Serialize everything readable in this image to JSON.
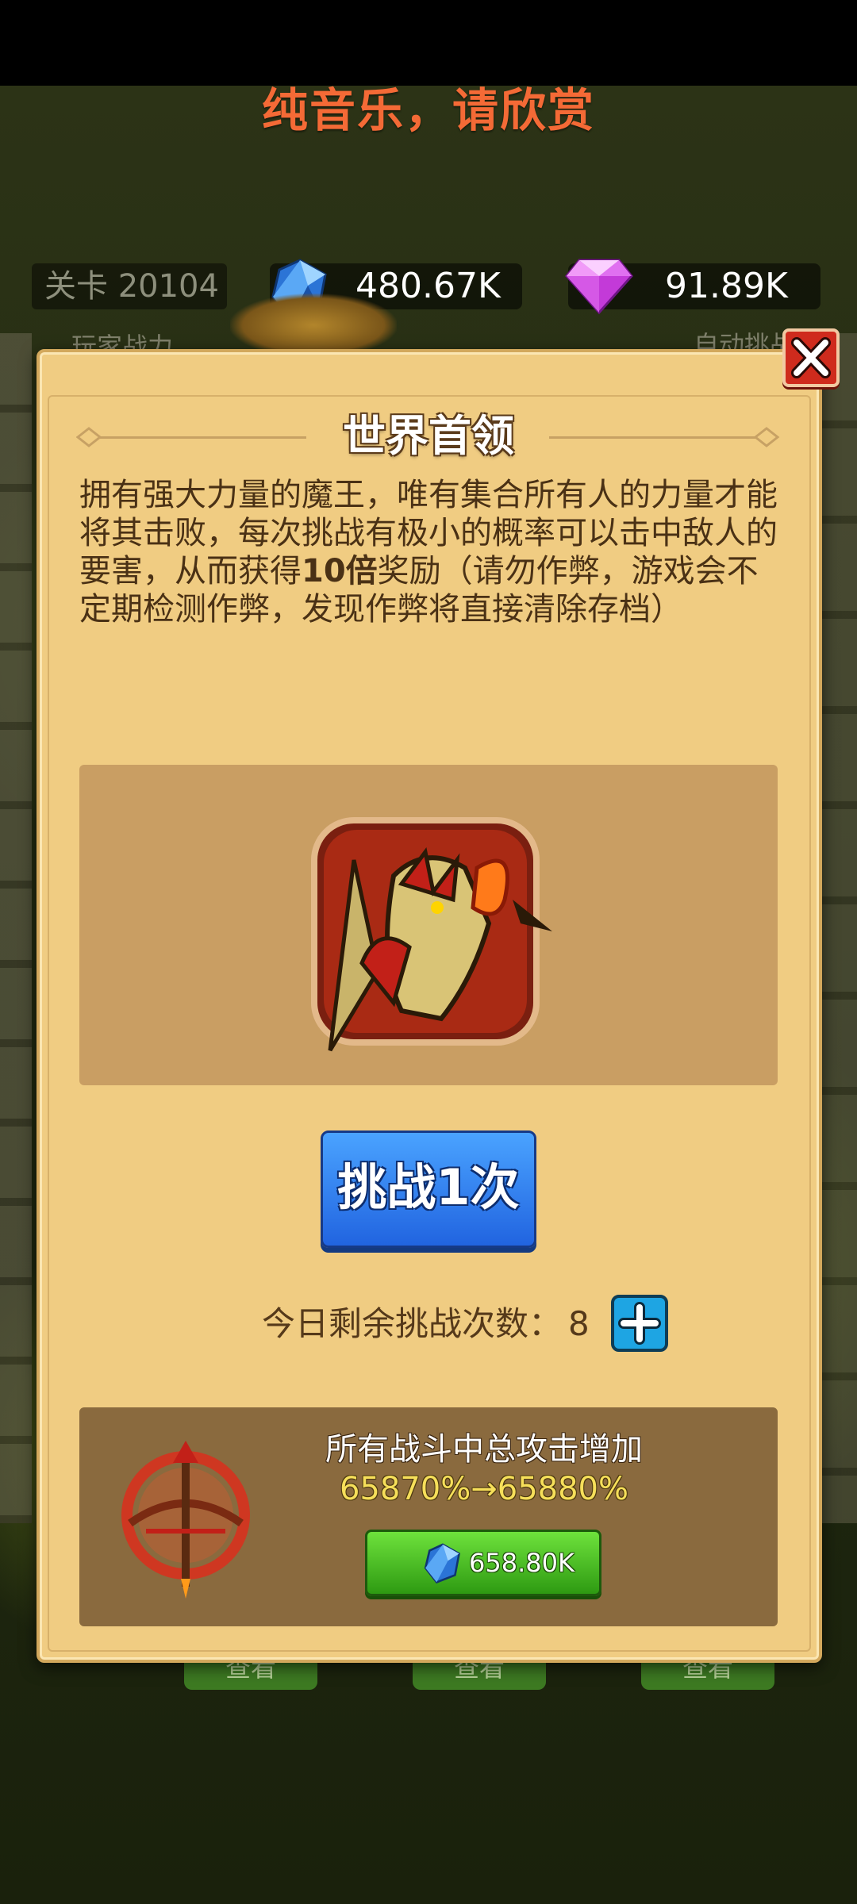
{
  "background": {
    "music_notice": "纯音乐，请欣赏",
    "level_label": "关卡 20104",
    "gold_amount": "480.67K",
    "gem_amount": "91.89K",
    "tab_left_text": "玩家战力",
    "tab_right_text": "自动挑战",
    "bottom_btn_text": "查看"
  },
  "dialog": {
    "title": "世界首领",
    "description_part1": "拥有强大力量的魔王，唯有集合所有人的力量才能将其击败，每次挑战有极小的概率可以击中敌人的要害，从而获得",
    "description_bold": "10倍",
    "description_part2": "奖励（请勿作弊，游戏会不定期检测作弊，发现作弊将直接清除存档）",
    "challenge_button": "挑战1次",
    "remaining_label": "今日剩余挑战次数：",
    "remaining_count": "8",
    "upgrade_title": "所有战斗中总攻击增加",
    "upgrade_value": "65870%→65880%",
    "upgrade_cost": "658.80K"
  },
  "icons": {
    "close": "close-icon",
    "gold": "blue-crystal-icon",
    "gem": "purple-diamond-icon",
    "boss": "dragon-boss-portrait",
    "plus": "plus-icon",
    "crossbow": "crossbow-icon"
  },
  "colors": {
    "panel": "#f0cc82",
    "challenge_button": "#2f7df0",
    "buy_button": "#4cc020",
    "close_button": "#cf2b1d",
    "music_text": "#f46a36",
    "upgrade_value": "#f6df5a"
  }
}
